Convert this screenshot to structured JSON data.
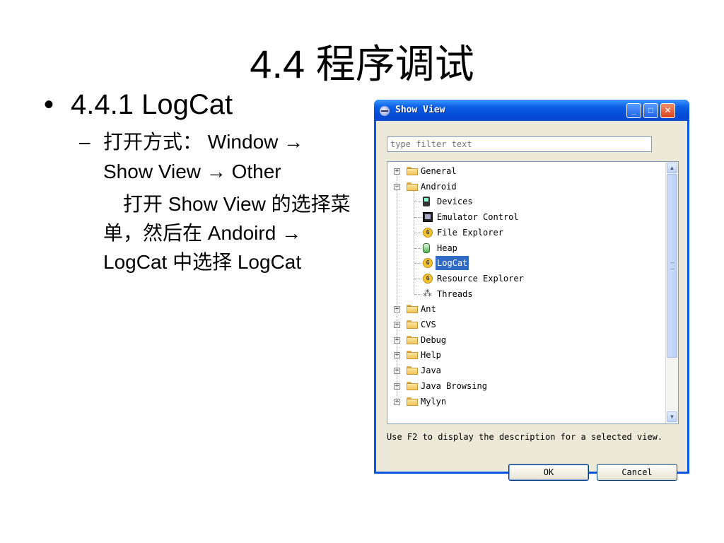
{
  "slide": {
    "title": "4.4  程序调试",
    "bullet_marker": "•",
    "bullet": "4.4.1 LogCat",
    "sub_marker": "–",
    "sub_text": "打开方式： Window → Show View → Other",
    "para": "　打开 Show View 的选择菜单，然后在 Andoird → LogCat 中选择 LogCat"
  },
  "dialog": {
    "title": "Show View",
    "filter_placeholder": "type filter text",
    "tree": [
      {
        "label": "General",
        "expander": "+",
        "icon": "folder-icon"
      },
      {
        "label": "Android",
        "expander": "−",
        "icon": "folder-icon"
      },
      {
        "label": "Devices",
        "icon": "device-icon"
      },
      {
        "label": "Emulator Control",
        "icon": "emulator-control-icon"
      },
      {
        "label": "File Explorer",
        "icon": "ddms-icon"
      },
      {
        "label": "Heap",
        "icon": "heap-icon"
      },
      {
        "label": "LogCat",
        "icon": "ddms-icon",
        "selected": true
      },
      {
        "label": "Resource Explorer",
        "icon": "ddms-icon"
      },
      {
        "label": "Threads",
        "icon": "threads-icon"
      },
      {
        "label": "Ant",
        "expander": "+",
        "icon": "folder-icon"
      },
      {
        "label": "CVS",
        "expander": "+",
        "icon": "folder-icon"
      },
      {
        "label": "Debug",
        "expander": "+",
        "icon": "folder-icon"
      },
      {
        "label": "Help",
        "expander": "+",
        "icon": "folder-icon"
      },
      {
        "label": "Java",
        "expander": "+",
        "icon": "folder-icon"
      },
      {
        "label": "Java Browsing",
        "expander": "+",
        "icon": "folder-icon"
      },
      {
        "label": "Mylyn",
        "expander": "+",
        "icon": "folder-icon"
      }
    ],
    "hint": "Use F2 to display the description for a selected view.",
    "ok_label": "OK",
    "cancel_label": "Cancel",
    "ddms_glyph": "G",
    "threads_glyph": "⁂",
    "titlebar_buttons": {
      "minimize": "_",
      "maximize": "□",
      "close": "✕"
    },
    "colors": {
      "titlebar": "#0a5fe6",
      "selection": "#316ac5",
      "dialog_bg": "#ece9d8"
    }
  }
}
